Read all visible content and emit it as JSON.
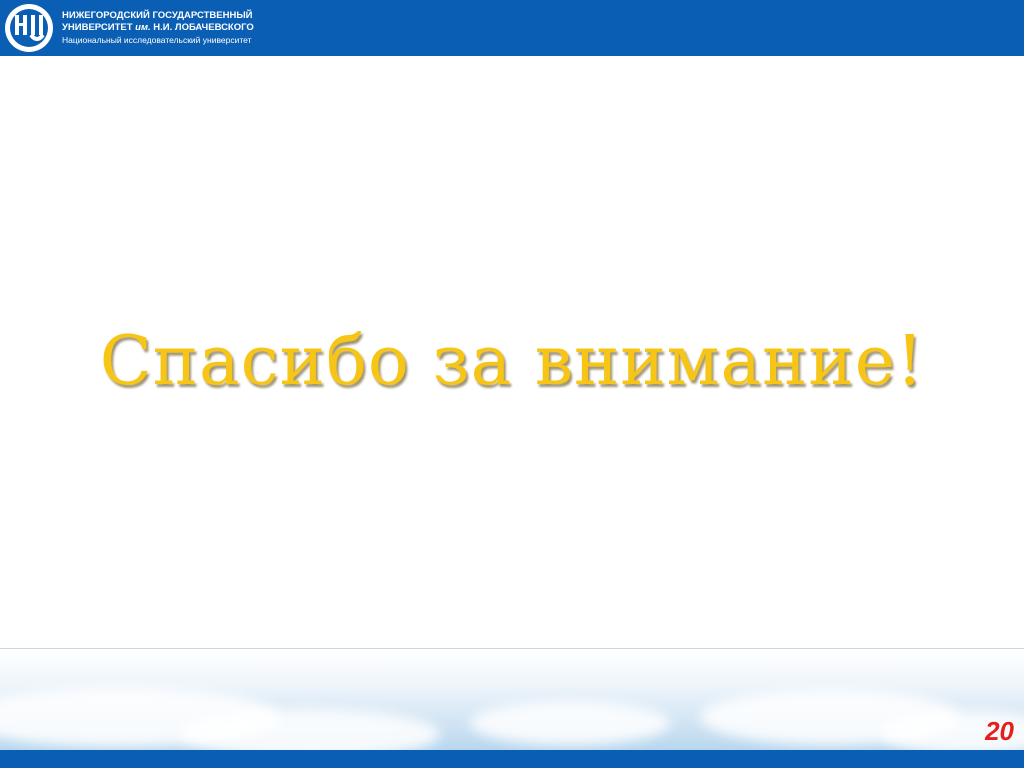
{
  "header": {
    "university_line1": "НИЖЕГОРОДСКИЙ ГОСУДАРСТВЕННЫЙ",
    "university_line2_prefix": "УНИВЕРСИТЕТ ",
    "university_line2_im": "им.",
    "university_line2_suffix": " Н.И. ЛОБАЧЕВСКОГО",
    "university_line3": "Национальный исследовательский университет",
    "logo_letters": "ННГУ",
    "bar_color": "#0a5fb4"
  },
  "slide": {
    "title": "Спасибо за внимание!",
    "title_color": "#f7c515"
  },
  "footer": {
    "page_number": "20",
    "page_number_color": "#e4201b"
  }
}
